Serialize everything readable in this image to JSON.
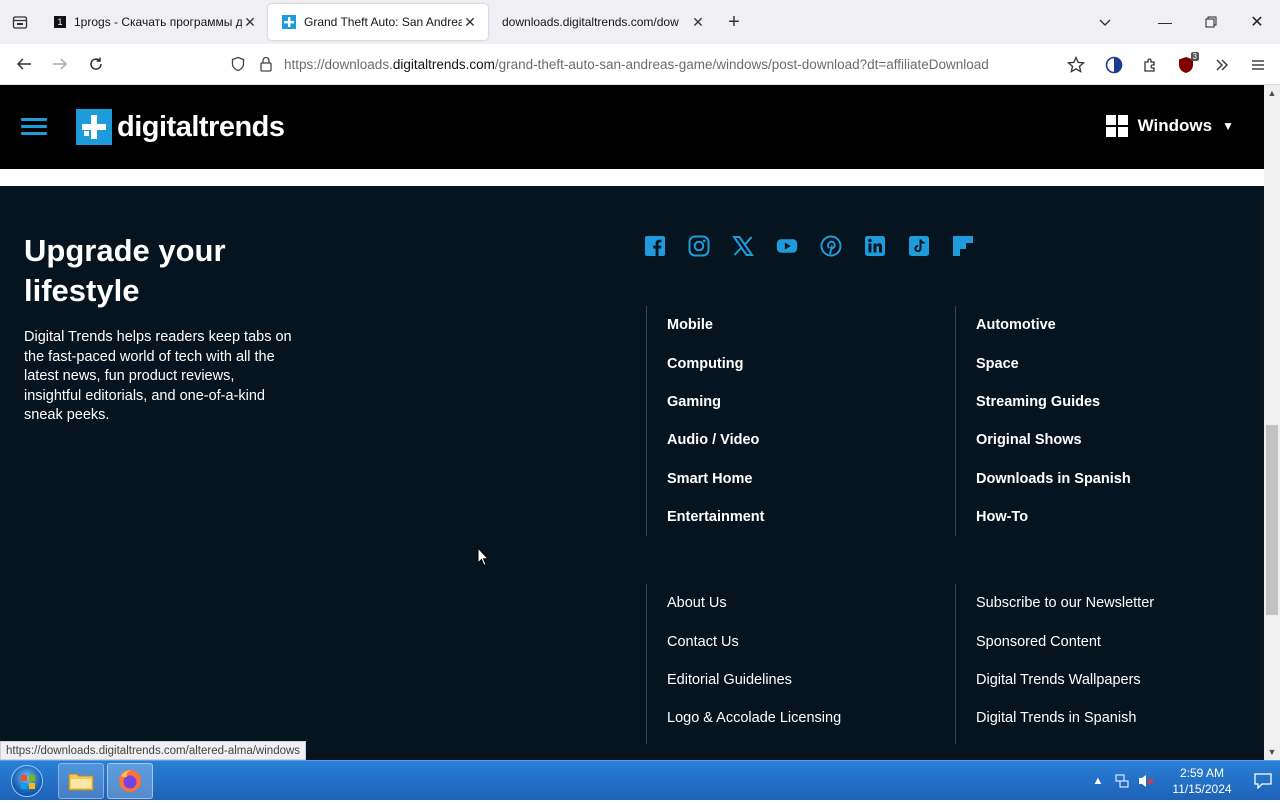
{
  "browser": {
    "tabs": [
      {
        "title": "1progs - Скачать программы д",
        "favicon_text": "1",
        "active": false
      },
      {
        "title": "Grand Theft Auto: San Andreas",
        "favicon_text": "+",
        "active": true
      },
      {
        "title": "downloads.digitaltrends.com/dow",
        "favicon_text": "",
        "active": false
      }
    ],
    "url_prefix": "https://downloads.",
    "url_host": "digitaltrends.com",
    "url_path": "/grand-theft-auto-san-andreas-game/windows/post-download?dt=affiliateDownload",
    "extension_badge": "3"
  },
  "site": {
    "logo_text": "digitaltrends",
    "os_selector": "Windows",
    "brand_color": "#1e9bdb"
  },
  "footer": {
    "title": "Upgrade your lifestyle",
    "description": "Digital Trends helps readers keep tabs on the fast-paced world of tech with all the latest news, fun product reviews, insightful editorials, and one-of-a-kind sneak peeks.",
    "social": [
      "facebook-icon",
      "instagram-icon",
      "x-icon",
      "youtube-icon",
      "pinterest-icon",
      "linkedin-icon",
      "tiktok-icon",
      "flipboard-icon"
    ],
    "categories_left": [
      "Mobile",
      "Computing",
      "Gaming",
      "Audio / Video",
      "Smart Home",
      "Entertainment"
    ],
    "categories_right": [
      "Automotive",
      "Space",
      "Streaming Guides",
      "Original Shows",
      "Downloads in Spanish",
      "How-To"
    ],
    "links_left": [
      "About Us",
      "Contact Us",
      "Editorial Guidelines",
      "Logo & Accolade Licensing"
    ],
    "links_right": [
      "Subscribe to our Newsletter",
      "Sponsored Content",
      "Digital Trends Wallpapers",
      "Digital Trends in Spanish"
    ]
  },
  "status_url": "https://downloads.digitaltrends.com/altered-alma/windows",
  "taskbar": {
    "time": "2:59 AM",
    "date": "11/15/2024"
  }
}
